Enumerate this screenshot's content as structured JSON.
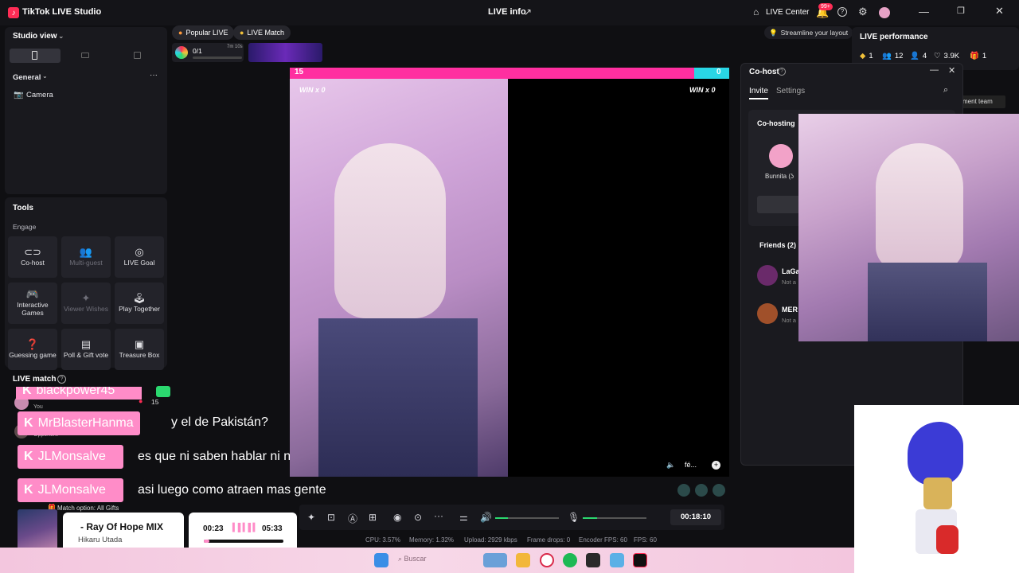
{
  "app": {
    "title": "TikTok LIVE Studio",
    "window_title": "LIVE info"
  },
  "header": {
    "live_center": "LIVE Center",
    "notif_badge": "99+"
  },
  "sidebar": {
    "studio_view": "Studio view",
    "general": "General",
    "camera": "Camera",
    "tools_title": "Tools",
    "engage": "Engage",
    "tools": [
      {
        "label": "Co-host",
        "icon": "link-icon"
      },
      {
        "label": "Multi-guest",
        "icon": "users-icon"
      },
      {
        "label": "LIVE Goal",
        "icon": "target-icon"
      },
      {
        "label": "Interactive Games",
        "icon": "gamepad-icon"
      },
      {
        "label": "Viewer Wishes",
        "icon": "gift-icon"
      },
      {
        "label": "Play Together",
        "icon": "joystick-icon"
      },
      {
        "label": "Guessing game",
        "icon": "question-icon"
      },
      {
        "label": "Poll & Gift vote",
        "icon": "poll-icon"
      },
      {
        "label": "Treasure Box",
        "icon": "box-icon"
      }
    ],
    "live_match": "LIVE match",
    "you": "You",
    "opponent": "Opponent",
    "you_score": "15",
    "match_option": "Match option: All Gifts"
  },
  "topbar": {
    "popular_live": "Popular LIVE",
    "live_match": "LIVE Match",
    "progress": "0/1",
    "progress_note": "7m 10s",
    "streamline": "Streamline your layout"
  },
  "match": {
    "left_score": "15",
    "right_score": "0",
    "win_left": "WIN x 0",
    "win_right": "WIN x 0",
    "opponent_name": "fé..."
  },
  "chat": [
    {
      "user": "blackpower45",
      "message": ""
    },
    {
      "user": "MrBlasterHanma",
      "message": "y el de Pakistán?"
    },
    {
      "user": "JLMonsalve",
      "message": "es que ni saben hablar ni nada"
    },
    {
      "user": "JLMonsalve",
      "message": "asi luego como atraen mas gente"
    }
  ],
  "music": {
    "title": "- Ray Of Hope MIX",
    "artist": "Hikaru Utada",
    "elapsed": "00:23",
    "total": "05:33",
    "progress": 0.07
  },
  "controls": {
    "timer": "00:18:10"
  },
  "stats": {
    "cpu": "CPU: 3.57%",
    "memory": "Memory: 1.32%",
    "upload": "Upload: 2929 kbps",
    "frame_drops": "Frame drops: 0",
    "encoder_fps": "Encoder FPS: 60",
    "fps": "FPS: 60"
  },
  "performance": {
    "title": "LIVE performance",
    "diamonds": "1",
    "viewers": "12",
    "new_followers": "4",
    "likes": "3.9K",
    "gifts": "1",
    "tag": "ment team"
  },
  "cohost": {
    "title": "Co-host",
    "tab_invite": "Invite",
    "tab_settings": "Settings",
    "hosting": "Co-hosting",
    "host_name": "Bunnita (ʖ",
    "friends": "Friends (2)",
    "friend1": "LaGa",
    "friend1_status": "Not a",
    "friend2": "MER",
    "friend2_status": "Not a"
  },
  "taskbar": {
    "search": "Buscar"
  },
  "colors": {
    "accent": "#fe2c55",
    "chat_pink": "#ff8cc8",
    "bar_pink": "#ff2fa0",
    "bar_cyan": "#29d6e6",
    "green": "#2bd86f"
  }
}
